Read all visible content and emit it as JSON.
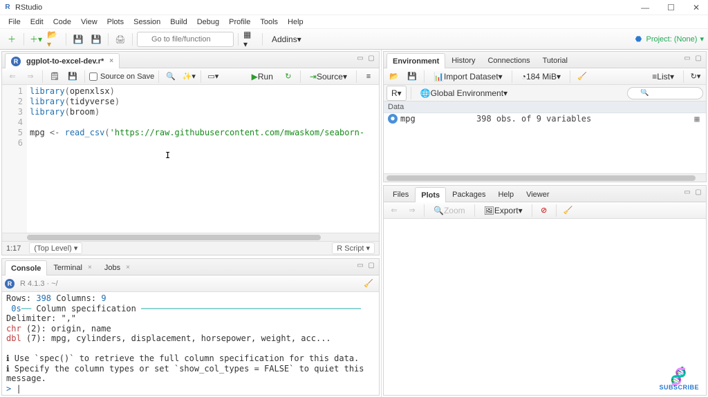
{
  "app": {
    "title": "RStudio"
  },
  "menubar": [
    "File",
    "Edit",
    "Code",
    "View",
    "Plots",
    "Session",
    "Build",
    "Debug",
    "Profile",
    "Tools",
    "Help"
  ],
  "toolbar": {
    "goto_placeholder": "Go to file/function",
    "addins_label": "Addins",
    "project_label": "Project: (None)"
  },
  "source": {
    "tab_label": "ggplot-to-excel-dev.r*",
    "source_on_save": "Source on Save",
    "run_label": "Run",
    "source_btn": "Source",
    "lines": [
      {
        "n": 1,
        "kw": "library",
        "arg": "openxlsx"
      },
      {
        "n": 2,
        "kw": "library",
        "arg": "tidyverse"
      },
      {
        "n": 3,
        "kw": "library",
        "arg": "broom"
      },
      {
        "n": 4,
        "raw": ""
      },
      {
        "n": 5,
        "assign": {
          "lhs": "mpg",
          "rhs_fn": "read_csv",
          "rhs_str": "'https://raw.githubusercontent.com/mwaskom/seaborn-"
        }
      },
      {
        "n": 6,
        "raw": ""
      }
    ],
    "cursor_pos": "1:17",
    "scope": "(Top Level)",
    "lang": "R Script"
  },
  "console": {
    "tabs": [
      "Console",
      "Terminal",
      "Jobs"
    ],
    "prompt_info": "R 4.1.3 · ~/",
    "lines": {
      "rows_cols": {
        "rows_label": "Rows:",
        "rows": "398",
        "cols_label": "Columns:",
        "cols": "9"
      },
      "spec_head": {
        "prefix": "0s",
        "dash": "──",
        "txt": "Column specification",
        "trail": "────────────────────────────────────────────"
      },
      "delim": "Delimiter: \",\"",
      "chr": {
        "key": "chr",
        "n": "(2)",
        "rest": ": origin, name"
      },
      "dbl": {
        "key": "dbl",
        "n": "(7)",
        "rest": ": mpg, cylinders, displacement, horsepower, weight, acc..."
      },
      "hint1": "ℹ Use `spec()` to retrieve the full column specification for this data.",
      "hint2": "ℹ Specify the column types or set `show_col_types = FALSE` to quiet this message.",
      "prompt": ">"
    }
  },
  "env": {
    "tabs": [
      "Environment",
      "History",
      "Connections",
      "Tutorial"
    ],
    "import_label": "Import Dataset",
    "mem": "184 MiB",
    "view_mode": "List",
    "scope_r": "R",
    "scope_env": "Global Environment",
    "data_header": "Data",
    "vars": [
      {
        "name": "mpg",
        "desc": "398 obs. of 9 variables"
      }
    ]
  },
  "plots": {
    "tabs": [
      "Files",
      "Plots",
      "Packages",
      "Help",
      "Viewer"
    ],
    "zoom": "Zoom",
    "export": "Export"
  },
  "subscribe": "SUBSCRIBE"
}
